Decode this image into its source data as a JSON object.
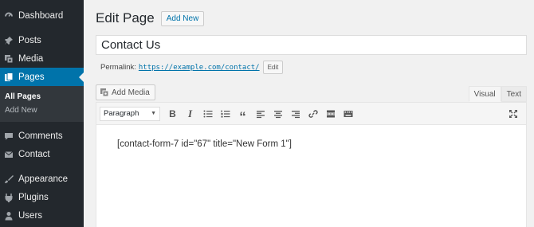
{
  "sidebar": {
    "items": [
      {
        "label": "Dashboard",
        "icon": "dashboard-icon"
      },
      {
        "label": "Posts",
        "icon": "pin-icon"
      },
      {
        "label": "Media",
        "icon": "media-icon"
      },
      {
        "label": "Pages",
        "icon": "pages-icon"
      },
      {
        "label": "Comments",
        "icon": "comment-icon"
      },
      {
        "label": "Contact",
        "icon": "mail-icon"
      },
      {
        "label": "Appearance",
        "icon": "brush-icon"
      },
      {
        "label": "Plugins",
        "icon": "plugin-icon"
      },
      {
        "label": "Users",
        "icon": "user-icon"
      }
    ],
    "submenu": [
      "All Pages",
      "Add New"
    ],
    "accent_color": "#0073aa"
  },
  "header": {
    "title": "Edit Page",
    "add_new_label": "Add New"
  },
  "post": {
    "title": "Contact Us",
    "permalink_label": "Permalink:",
    "permalink_url": "https://example.com/contact/",
    "edit_label": "Edit"
  },
  "editor": {
    "add_media_label": "Add Media",
    "tabs": [
      "Visual",
      "Text"
    ],
    "active_tab": "Visual",
    "format_value": "Paragraph",
    "toolbar_icons": [
      "bold-icon",
      "italic-icon",
      "bullet-list-icon",
      "numbered-list-icon",
      "blockquote-icon",
      "align-left-icon",
      "align-center-icon",
      "align-right-icon",
      "link-icon",
      "read-more-icon",
      "toolbar-toggle-icon"
    ],
    "bold_glyph": "B",
    "italic_glyph": "I",
    "quote_glyph": "“",
    "content": "[contact-form-7 id=\"67\" title=\"New Form 1\"]"
  }
}
